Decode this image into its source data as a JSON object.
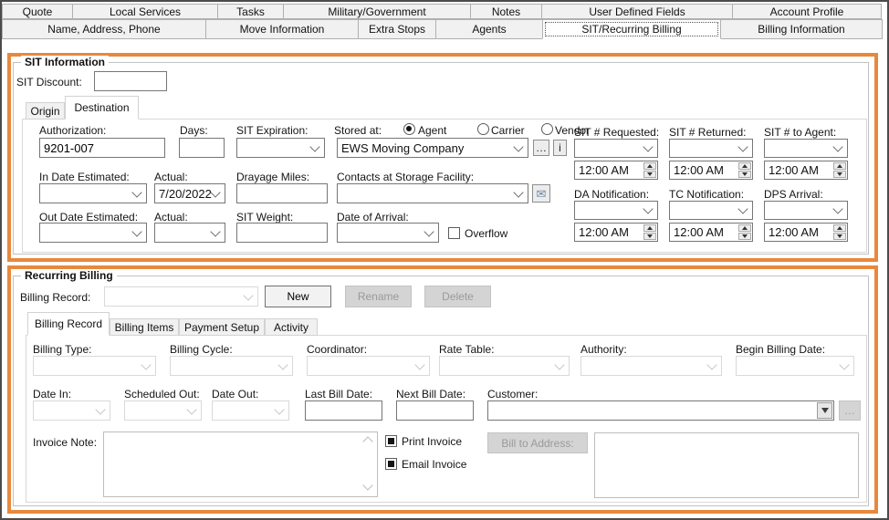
{
  "colors": {
    "highlight_orange": "#E8883C"
  },
  "icons": {
    "mail": "✉",
    "ellipsis": "…",
    "info": "i"
  },
  "tabs_row1": [
    "Quote",
    "Local Services",
    "Tasks",
    "Military/Government",
    "Notes",
    "User Defined Fields",
    "Account Profile"
  ],
  "tabs_row2": [
    "Name, Address, Phone",
    "Move Information",
    "Extra Stops",
    "Agents",
    "SIT/Recurring Billing",
    "Billing Information"
  ],
  "active_tab": "SIT/Recurring Billing",
  "sit": {
    "title": "SIT Information",
    "discount_label": "SIT Discount:",
    "discount_value": "",
    "subtab_origin": "Origin",
    "subtab_destination": "Destination",
    "active_subtab": "Destination",
    "authorization_label": "Authorization:",
    "authorization_value": "9201-007",
    "days_label": "Days:",
    "days_value": "",
    "expiration_label": "SIT Expiration:",
    "stored_at_label": "Stored at:",
    "radio_agent": "Agent",
    "radio_carrier": "Carrier",
    "radio_vendor": "Vendor",
    "stored_at_selected": "Agent",
    "storage_company": "EWS Moving Company",
    "requested_label": "SIT # Requested:",
    "returned_label": "SIT # Returned:",
    "to_agent_label": "SIT # to Agent:",
    "time_default": "12:00 AM",
    "in_date_label": "In Date Estimated:",
    "in_actual_label": "Actual:",
    "in_actual_value": "7/20/2022",
    "drayage_label": "Drayage Miles:",
    "drayage_value": "",
    "contacts_label": "Contacts at Storage Facility:",
    "da_label": "DA Notification:",
    "tc_label": "TC Notification:",
    "dps_label": "DPS Arrival:",
    "out_date_label": "Out Date Estimated:",
    "out_actual_label": "Actual:",
    "weight_label": "SIT Weight:",
    "weight_value": "",
    "arrival_label": "Date of Arrival:",
    "overflow_label": "Overflow",
    "overflow_checked": false
  },
  "recurring": {
    "title": "Recurring Billing",
    "record_label": "Billing Record:",
    "record_value": "",
    "new_button": "New",
    "rename_button": "Rename",
    "delete_button": "Delete",
    "subtabs": [
      "Billing Record",
      "Billing Items",
      "Payment Setup",
      "Activity"
    ],
    "active_subtab": "Billing Record",
    "billing_type_label": "Billing Type:",
    "billing_cycle_label": "Billing Cycle:",
    "coordinator_label": "Coordinator:",
    "rate_table_label": "Rate Table:",
    "authority_label": "Authority:",
    "begin_date_label": "Begin Billing Date:",
    "date_in_label": "Date In:",
    "scheduled_out_label": "Scheduled Out:",
    "date_out_label": "Date Out:",
    "last_bill_label": "Last Bill Date:",
    "last_bill_value": "",
    "next_bill_label": "Next Bill Date:",
    "next_bill_value": "",
    "customer_label": "Customer:",
    "customer_value": "",
    "invoice_note_label": "Invoice Note:",
    "invoice_note_value": "",
    "print_invoice_label": "Print Invoice",
    "print_invoice_checked": true,
    "email_invoice_label": "Email Invoice",
    "email_invoice_checked": true,
    "bill_to_address_button": "Bill to Address:"
  }
}
